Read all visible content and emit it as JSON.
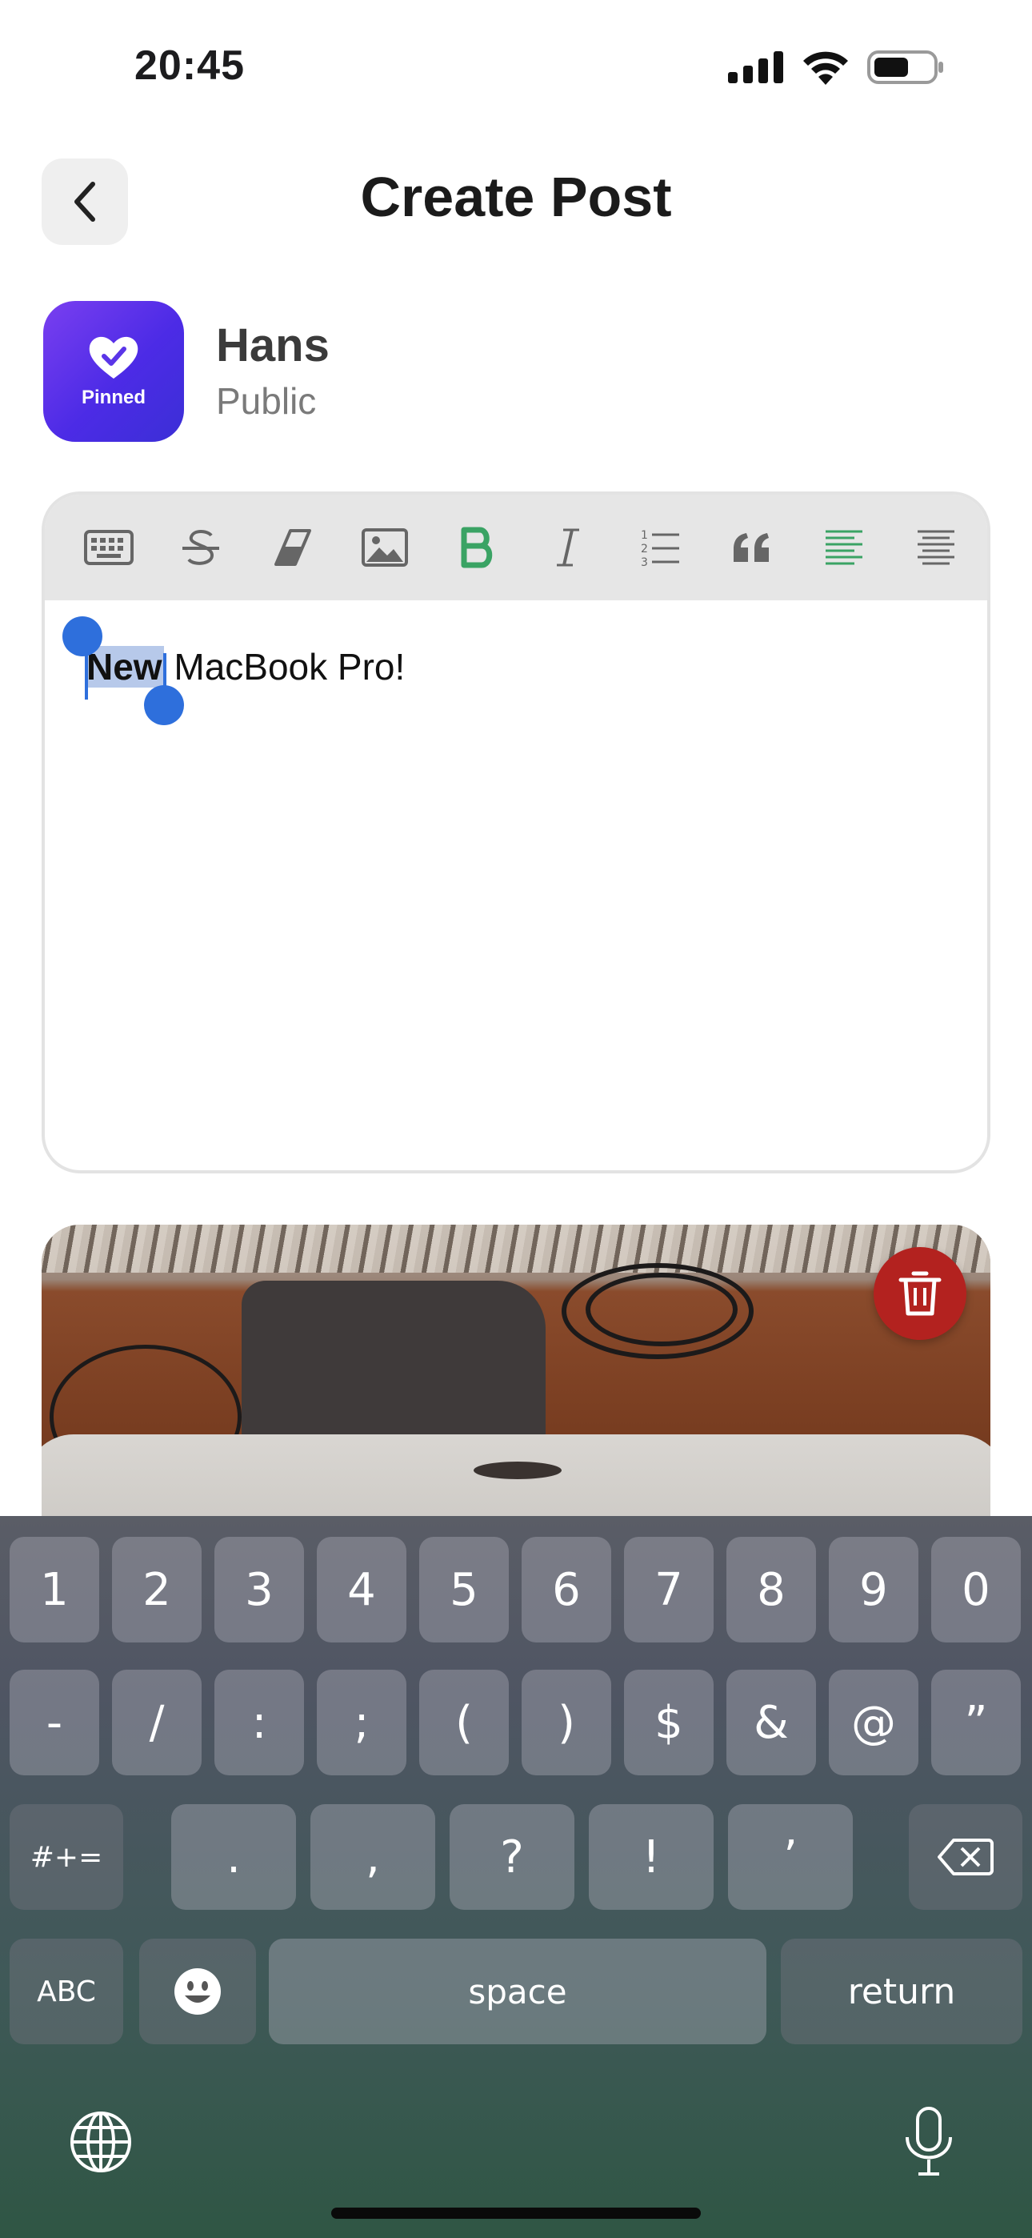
{
  "status_bar": {
    "time": "20:45",
    "icons": [
      "signal-icon",
      "wifi-icon",
      "battery-icon"
    ]
  },
  "header": {
    "title": "Create Post",
    "back_icon": "chevron-left-icon"
  },
  "user": {
    "name": "Hans",
    "visibility": "Public",
    "avatar_label": "Pinned"
  },
  "editor": {
    "toolbar": [
      "keyboard-icon",
      "strikethrough-icon",
      "eraser-icon",
      "image-icon",
      "bold-icon",
      "italic-icon",
      "numbered-list-icon",
      "quote-icon",
      "align-left-icon",
      "align-justify-icon"
    ],
    "active_color": "#3aa364",
    "selected_text": "New",
    "rest_text": " MacBook Pro!"
  },
  "keyboard": {
    "row1": [
      "1",
      "2",
      "3",
      "4",
      "5",
      "6",
      "7",
      "8",
      "9",
      "0"
    ],
    "row2": [
      "-",
      "/",
      ":",
      ";",
      "(",
      ")",
      "$",
      "&",
      "@",
      "”"
    ],
    "row3_toggle": "#+=",
    "row3": [
      ".",
      ",",
      "?",
      "!",
      "’"
    ],
    "abc": "ABC",
    "space": "space",
    "return": "return"
  }
}
